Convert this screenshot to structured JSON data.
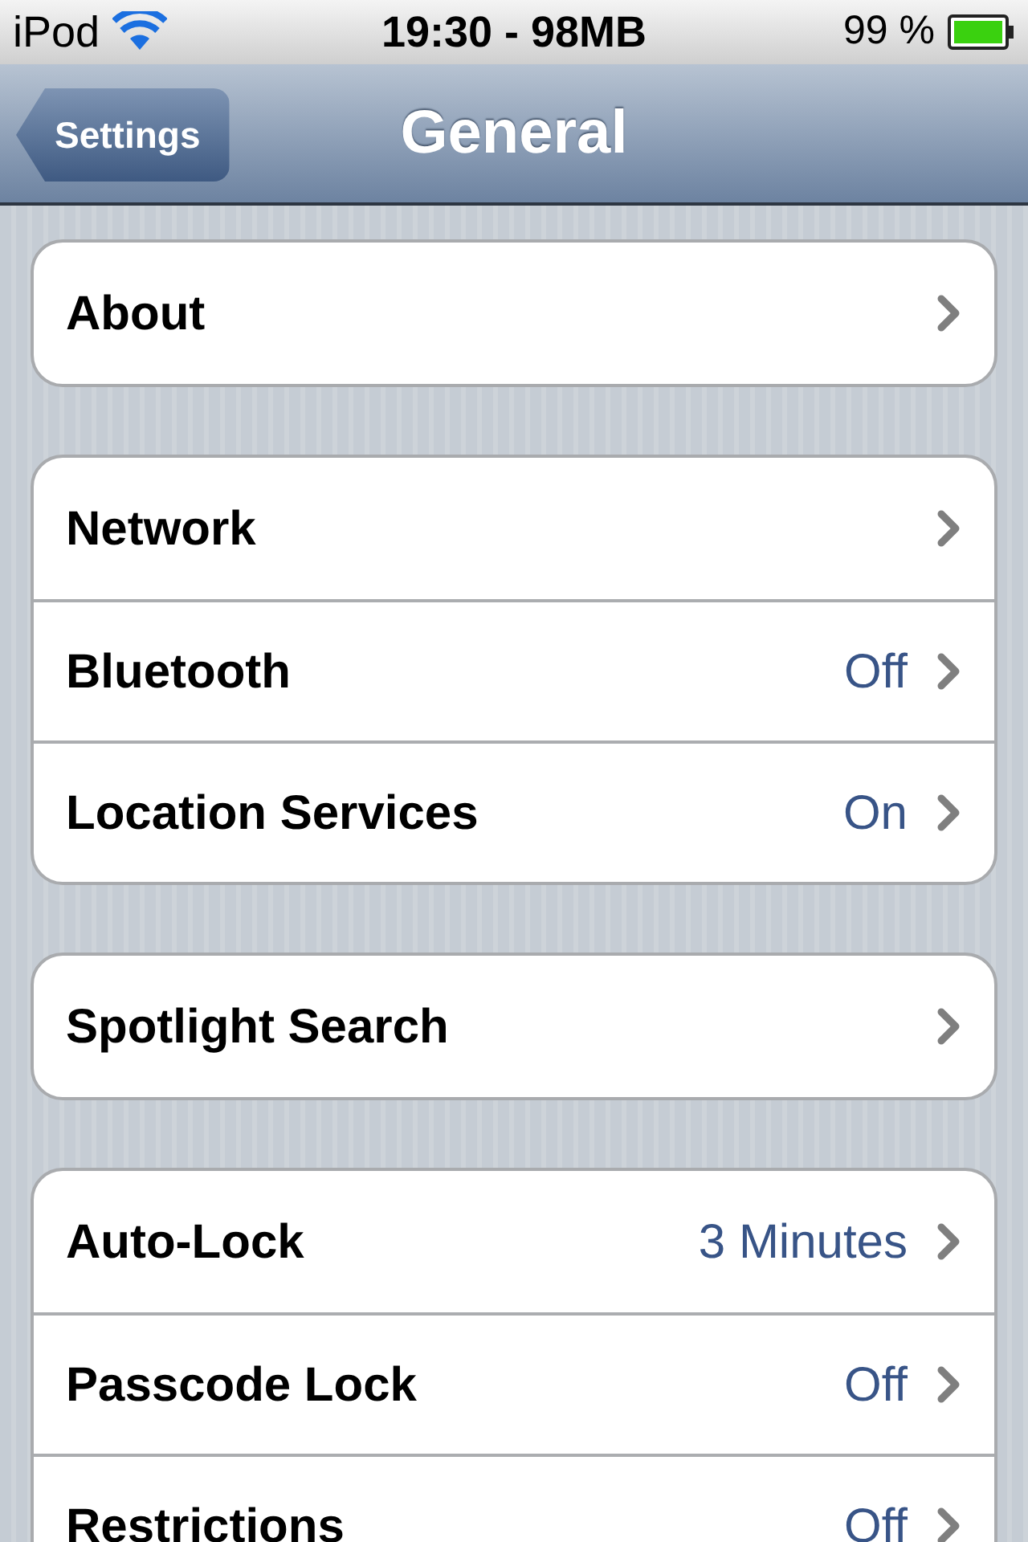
{
  "status_bar": {
    "carrier": "iPod",
    "time": "19:30 - 98MB",
    "battery": "99 %"
  },
  "nav_bar": {
    "back_button": "Settings",
    "title": "General"
  },
  "groups": [
    {
      "rows": [
        {
          "label": "About"
        }
      ]
    },
    {
      "rows": [
        {
          "label": "Network"
        },
        {
          "label": "Bluetooth",
          "value": "Off"
        },
        {
          "label": "Location Services",
          "value": "On"
        }
      ]
    },
    {
      "rows": [
        {
          "label": "Spotlight Search"
        }
      ]
    },
    {
      "rows": [
        {
          "label": "Auto-Lock",
          "value": "3 Minutes"
        },
        {
          "label": "Passcode Lock",
          "value": "Off"
        },
        {
          "label": "Restrictions",
          "value": "Off"
        }
      ]
    }
  ]
}
